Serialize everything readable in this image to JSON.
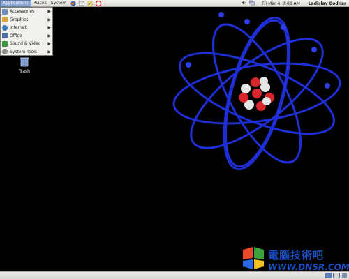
{
  "top_panel": {
    "menus": [
      "Applications",
      "Places",
      "System"
    ],
    "launchers": [
      "firefox-icon",
      "mail-icon",
      "notes-icon",
      "help-icon"
    ],
    "clock": "Fri Mar  4,  7:08 AM",
    "user": "Ladislav Bodnar"
  },
  "apps_menu": {
    "items": [
      {
        "label": "Accessories",
        "icon": "accessories-icon",
        "color": "#6d8fbf"
      },
      {
        "label": "Graphics",
        "icon": "graphics-icon",
        "color": "#d9a53a"
      },
      {
        "label": "Internet",
        "icon": "internet-icon",
        "color": "#3f7fbf"
      },
      {
        "label": "Office",
        "icon": "office-icon",
        "color": "#4b6fa3"
      },
      {
        "label": "Sound & Video",
        "icon": "sound-video-icon",
        "color": "#3b9a3b"
      },
      {
        "label": "System Tools",
        "icon": "system-tools-icon",
        "color": "#8a8a8a"
      }
    ]
  },
  "desktop": {
    "icons": [
      {
        "label": "Trash",
        "icon": "trash-icon"
      }
    ]
  },
  "watermark": {
    "text_cn": "電腦技術吧",
    "text_url": "WWW.DNSR.COM"
  },
  "colors": {
    "orbit": "#1f2fd6",
    "electron": "#2a3ee8",
    "proton": "#d8262c",
    "neutron": "#e6e6e6",
    "panel_active": "#8fa9d6"
  }
}
